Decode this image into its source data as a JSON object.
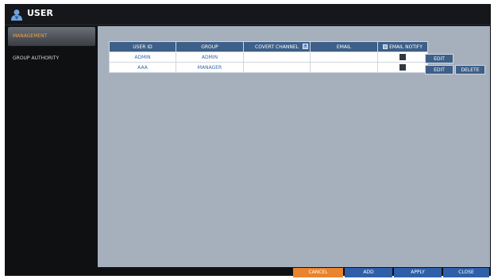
{
  "header": {
    "title": "USER"
  },
  "sidebar": {
    "items": [
      {
        "label": "MANAGEMENT"
      },
      {
        "label": "GROUP AUTHORITY"
      }
    ]
  },
  "table": {
    "columns": [
      "USER ID",
      "GROUP",
      "COVERT CHANNEL",
      "EMAIL",
      "EMAIL NOTIFY"
    ],
    "rows": [
      {
        "user_id": "ADMIN",
        "group": "ADMIN",
        "covert_channel": "",
        "email": "",
        "actions": [
          "EDIT"
        ]
      },
      {
        "user_id": "AAA",
        "group": "MANAGER",
        "covert_channel": "",
        "email": "",
        "actions": [
          "EDIT",
          "DELETE"
        ]
      }
    ]
  },
  "footer": {
    "cancel": "CANCEL",
    "add": "ADD",
    "apply": "APPLY",
    "close": "CLOSE"
  },
  "colors": {
    "accent_orange": "#e8832f",
    "header_blue": "#3d5f88",
    "content_bg": "#a6b0bd"
  },
  "icons": {
    "title": "user-icon"
  }
}
